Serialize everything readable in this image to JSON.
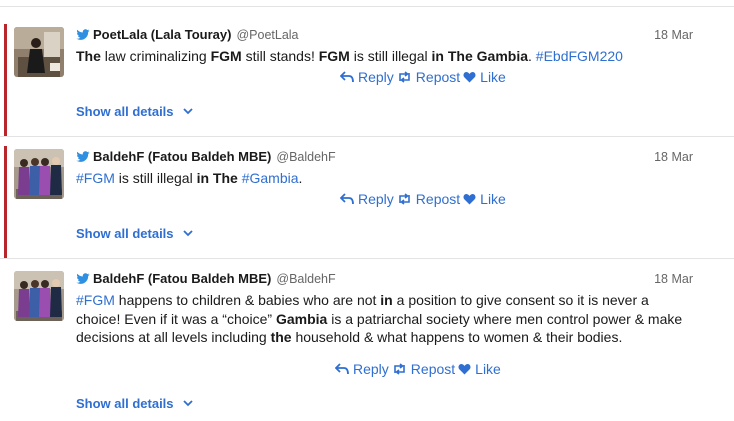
{
  "colors": {
    "link": "#2f6fd1",
    "accent_bar": "#b8262c",
    "handle": "#666666"
  },
  "tweets": [
    {
      "name": "PoetLala (Lala Touray)",
      "handle": "@PoetLala",
      "date": "18 Mar",
      "text_parts": [
        {
          "t": "The",
          "s": "b"
        },
        {
          "t": " law criminalizing ",
          "s": ""
        },
        {
          "t": "FGM",
          "s": "b"
        },
        {
          "t": " still stands! ",
          "s": ""
        },
        {
          "t": "FGM",
          "s": "b"
        },
        {
          "t": " is still illegal ",
          "s": ""
        },
        {
          "t": "in The Gambia",
          "s": "b"
        },
        {
          "t": ". ",
          "s": ""
        },
        {
          "t": "#EbdFGM220",
          "s": "tag"
        }
      ],
      "reply_label": "Reply",
      "repost_label": "Repost",
      "like_label": "Like",
      "details_label": "Show all details",
      "avatar_icon": "person-photo"
    },
    {
      "name": "BaldehF (Fatou Baldeh MBE)",
      "handle": "@BaldehF",
      "date": "18 Mar",
      "text_parts": [
        {
          "t": "#FGM",
          "s": "tag"
        },
        {
          "t": " is still illegal ",
          "s": ""
        },
        {
          "t": "in The",
          "s": "b"
        },
        {
          "t": " ",
          "s": ""
        },
        {
          "t": "#Gambia",
          "s": "tag"
        },
        {
          "t": ".",
          "s": ""
        }
      ],
      "reply_label": "Reply",
      "repost_label": "Repost",
      "like_label": "Like",
      "details_label": "Show all details",
      "avatar_icon": "group-photo"
    },
    {
      "name": "BaldehF (Fatou Baldeh MBE)",
      "handle": "@BaldehF",
      "date": "18 Mar",
      "text_parts": [
        {
          "t": "#FGM",
          "s": "tag"
        },
        {
          "t": " happens to children & babies who are not ",
          "s": ""
        },
        {
          "t": "in",
          "s": "b"
        },
        {
          "t": " a position to give consent so it is never a choice! Even if it was a “choice” ",
          "s": ""
        },
        {
          "t": "Gambia",
          "s": "b"
        },
        {
          "t": " is a patriarchal society where men control power & make decisions at all levels including ",
          "s": ""
        },
        {
          "t": "the",
          "s": "b"
        },
        {
          "t": " household & what happens to women & their bodies.",
          "s": ""
        }
      ],
      "reply_label": "Reply",
      "repost_label": "Repost",
      "like_label": "Like",
      "details_label": "Show all details",
      "avatar_icon": "group-photo"
    }
  ]
}
